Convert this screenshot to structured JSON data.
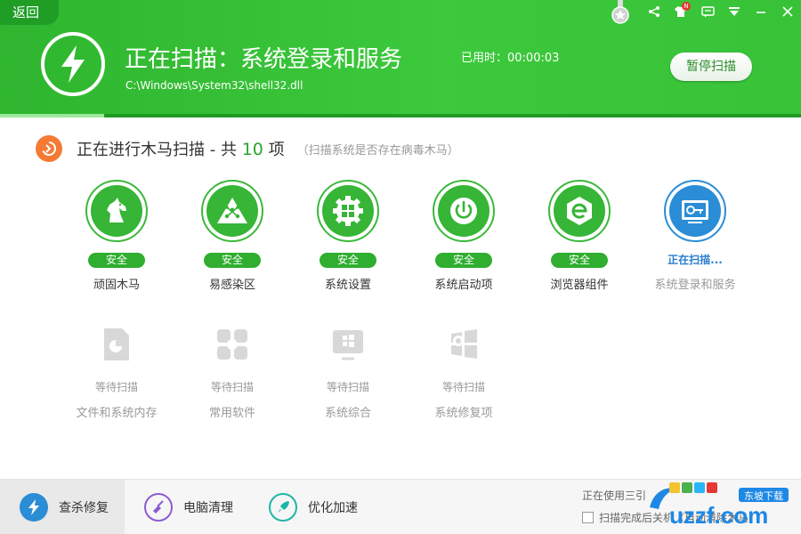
{
  "header": {
    "back_label": "返回",
    "scan_title": "正在扫描：系统登录和服务",
    "scan_path": "C:\\Windows\\System32\\shell32.dll",
    "elapsed_label": "已用时：00:00:03",
    "pause_label": "暂停扫描",
    "progress": 0.13,
    "badge_letter": "N"
  },
  "section": {
    "title_prefix": "正在进行木马扫描 - 共",
    "count": "10",
    "title_suffix": "项",
    "hint": "（扫描系统是否存在病毒木马）"
  },
  "items_done": [
    {
      "label": "顽固木马",
      "status": "安全",
      "icon": "horse-icon"
    },
    {
      "label": "易感染区",
      "status": "安全",
      "icon": "warning-triangle-icon"
    },
    {
      "label": "系统设置",
      "status": "安全",
      "icon": "gear-windows-icon"
    },
    {
      "label": "系统启动项",
      "status": "安全",
      "icon": "power-icon"
    },
    {
      "label": "浏览器组件",
      "status": "安全",
      "icon": "ie-icon"
    }
  ],
  "item_scanning": {
    "label": "系统登录和服务",
    "status": "正在扫描...",
    "icon": "service-login-icon"
  },
  "items_waiting": [
    {
      "label": "文件和系统内存",
      "status": "等待扫描",
      "icon": "file-chart-icon"
    },
    {
      "label": "常用软件",
      "status": "等待扫描",
      "icon": "software-grid-icon"
    },
    {
      "label": "系统综合",
      "status": "等待扫描",
      "icon": "system-monitor-icon"
    },
    {
      "label": "系统修复项",
      "status": "等待扫描",
      "icon": "windows-repair-icon"
    }
  ],
  "footer": {
    "tabs": [
      {
        "label": "查杀修复",
        "color": "#2a8dd6"
      },
      {
        "label": "电脑清理",
        "color": "#8c5bd1"
      },
      {
        "label": "优化加速",
        "color": "#1fb5a6"
      }
    ],
    "status_text": "正在使用三引",
    "checkbox_label": "扫描完成后关机（自动清除木马）",
    "watermark_text": "uzzf.com",
    "watermark_sub": "东坡下载"
  },
  "colors": {
    "header_green": "#36c236",
    "safe_green": "#2fae2f",
    "scan_blue": "#2a8dd6",
    "section_orange": "#f47a33"
  }
}
